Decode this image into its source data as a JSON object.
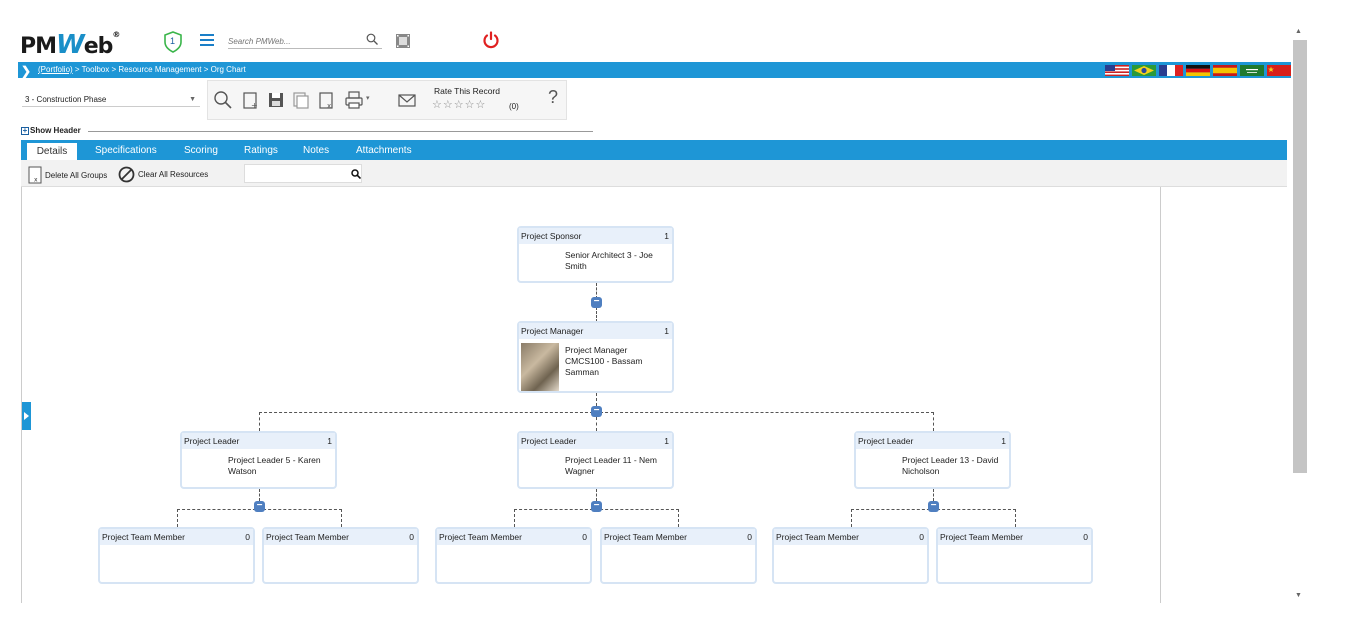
{
  "app": {
    "logo_text_pm": "PM",
    "logo_text_w": "W",
    "logo_text_eb": "eb",
    "logo_reg": "®",
    "notification_count": "1"
  },
  "search": {
    "placeholder": "Search PMWeb..."
  },
  "breadcrumb": {
    "portfolio": "(Portfolio)",
    "rest": " > Toolbox > Resource Management > Org Chart"
  },
  "languages": [
    "us-flag",
    "brazil-flag",
    "france-flag",
    "germany-flag",
    "spain-flag",
    "saudi-flag",
    "china-flag"
  ],
  "toolbar": {
    "phase": "3 - Construction Phase",
    "rate_label": "Rate This Record",
    "stars": "☆☆☆☆☆",
    "rate_count": "(0)",
    "help": "?"
  },
  "show_header": "Show Header",
  "tabs": [
    "Details",
    "Specifications",
    "Scoring",
    "Ratings",
    "Notes",
    "Attachments"
  ],
  "actions": {
    "delete_groups": "Delete All Groups",
    "clear_resources": "Clear All Resources"
  },
  "org": {
    "sponsor": {
      "title": "Project Sponsor",
      "count": "1",
      "name": "Senior Architect 3 - Joe Smith"
    },
    "manager": {
      "title": "Project Manager",
      "count": "1",
      "name": "Project Manager CMCS100 - Bassam Samman"
    },
    "leaders": [
      {
        "title": "Project Leader",
        "count": "1",
        "name": "Project Leader 5 - Karen Watson"
      },
      {
        "title": "Project Leader",
        "count": "1",
        "name": "Project Leader 11 - Nem Wagner"
      },
      {
        "title": "Project Leader",
        "count": "1",
        "name": "Project Leader 13 - David Nicholson"
      }
    ],
    "member": {
      "title": "Project Team Member",
      "count": "0"
    }
  },
  "colors": {
    "accent": "#1e96d6",
    "node_header": "#e8f0fa",
    "expand": "#4f7fc0",
    "power": "#e02020"
  }
}
